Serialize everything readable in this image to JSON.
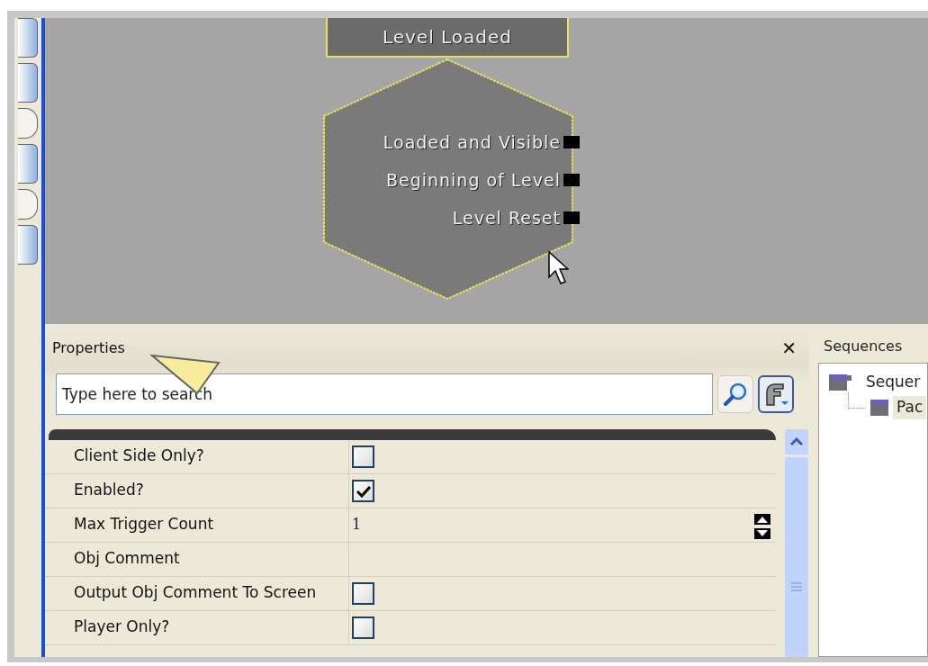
{
  "node": {
    "title": "Level Loaded",
    "outputs": [
      "Loaded and Visible",
      "Beginning of Level",
      "Level Reset"
    ]
  },
  "properties": {
    "title": "Properties",
    "close": "✕",
    "search": {
      "placeholder": "Type here to search"
    },
    "rows": [
      {
        "label": "Client Side Only?",
        "kind": "checkbox",
        "checked": false
      },
      {
        "label": "Enabled?",
        "kind": "checkbox",
        "checked": true
      },
      {
        "label": "Max Trigger Count",
        "kind": "number",
        "value": "1"
      },
      {
        "label": "Obj Comment",
        "kind": "text"
      },
      {
        "label": "Output Obj Comment To Screen",
        "kind": "checkbox",
        "checked": false
      },
      {
        "label": "Player Only?",
        "kind": "checkbox",
        "checked": false
      }
    ]
  },
  "sequences": {
    "title": "Sequences",
    "tree": [
      {
        "label": "Sequer",
        "selected": false,
        "children": [
          {
            "label": "Pac",
            "selected": true
          }
        ]
      }
    ]
  }
}
